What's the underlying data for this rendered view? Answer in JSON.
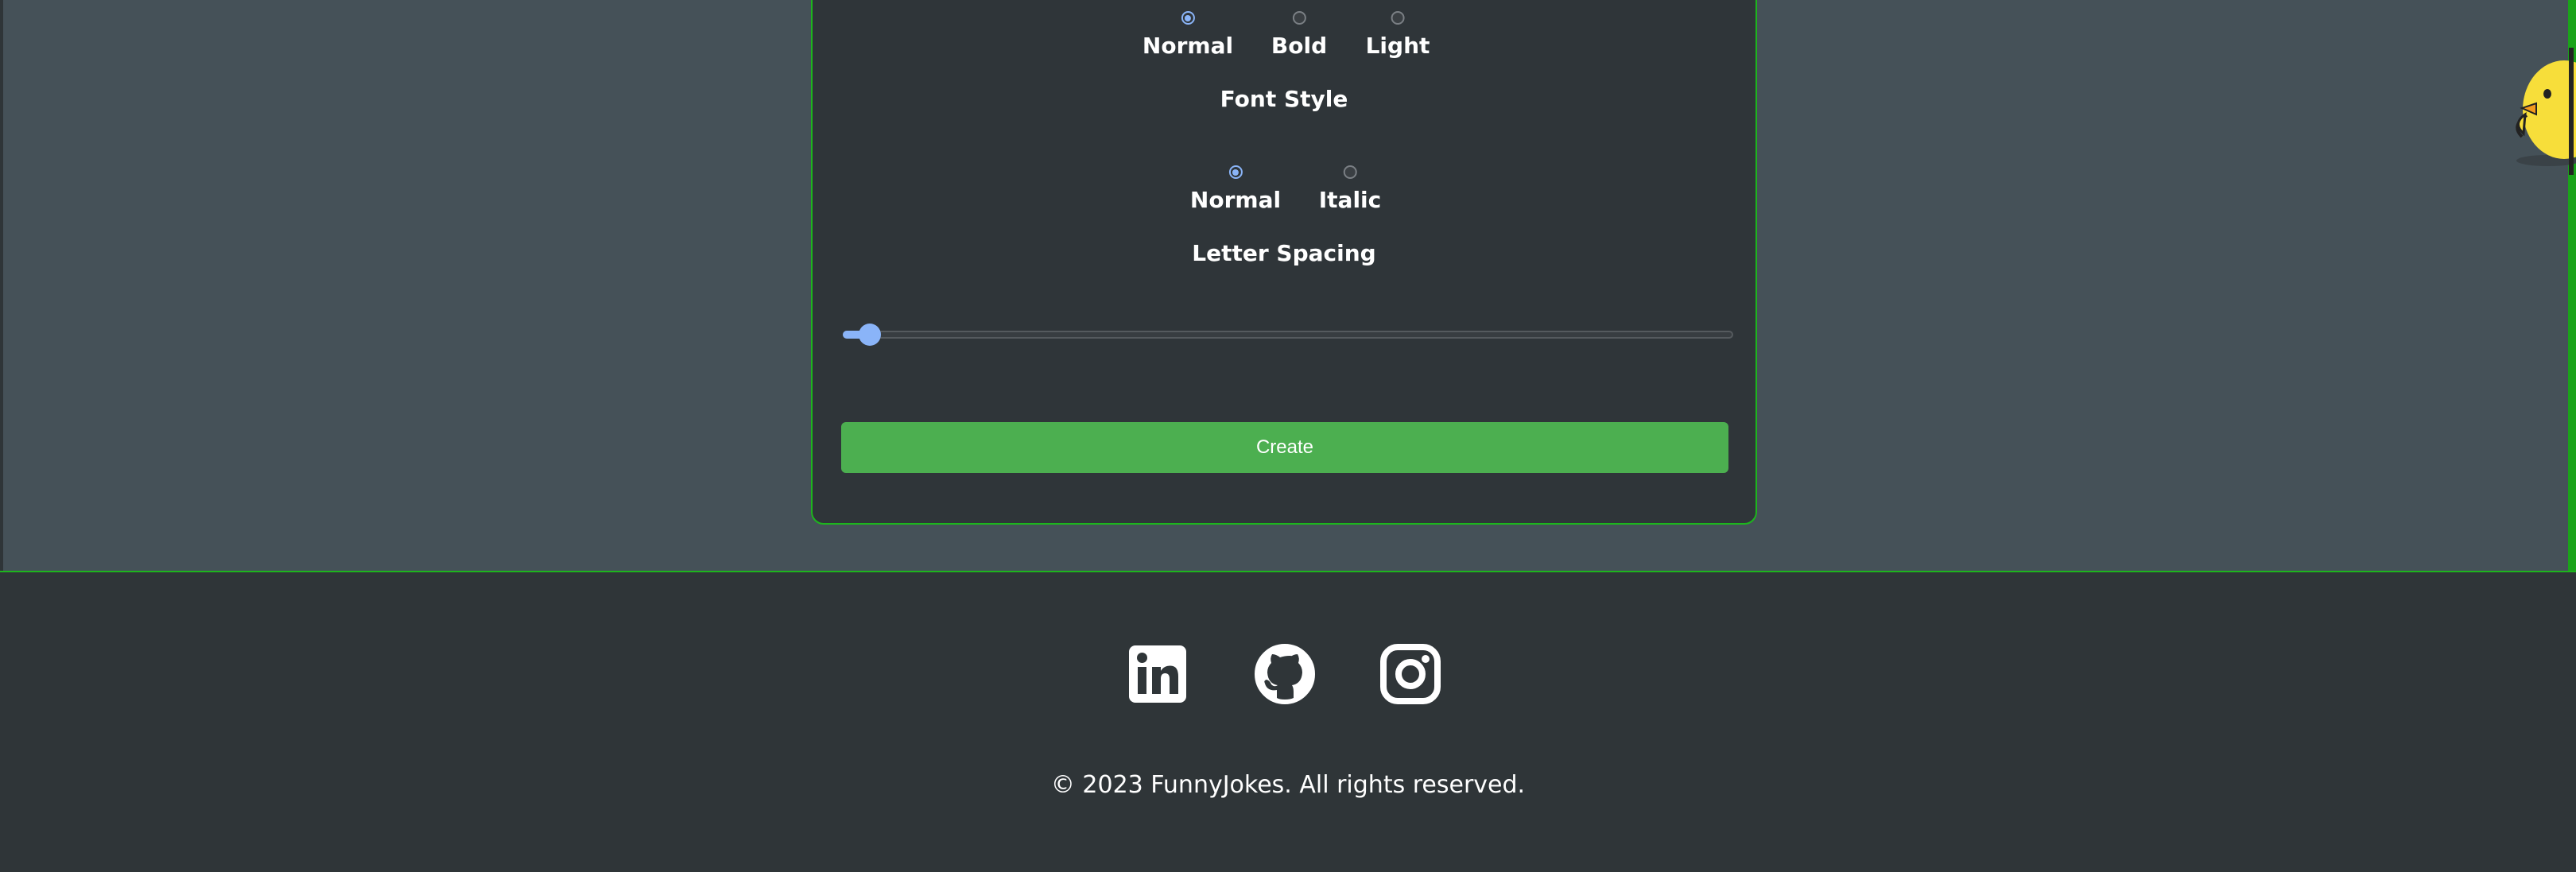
{
  "font_weight": {
    "options": [
      {
        "label": "Normal",
        "checked": true
      },
      {
        "label": "Bold",
        "checked": false
      },
      {
        "label": "Light",
        "checked": false
      }
    ]
  },
  "font_style": {
    "title": "Font Style",
    "options": [
      {
        "label": "Normal",
        "checked": true
      },
      {
        "label": "Italic",
        "checked": false
      }
    ]
  },
  "letter_spacing": {
    "title": "Letter Spacing",
    "value_fraction": 0.03
  },
  "create_button": {
    "label": "Create"
  },
  "footer": {
    "social": [
      {
        "icon": "linkedin-icon"
      },
      {
        "icon": "github-icon"
      },
      {
        "icon": "instagram-icon"
      }
    ],
    "copyright": "© 2023 FunnyJokes. All rights reserved."
  },
  "colors": {
    "accent_green": "#1db51d",
    "button_green": "#4caf50",
    "radio_blue": "#8ab4f8",
    "page_bg": "#455158",
    "card_bg": "#2f3539"
  }
}
